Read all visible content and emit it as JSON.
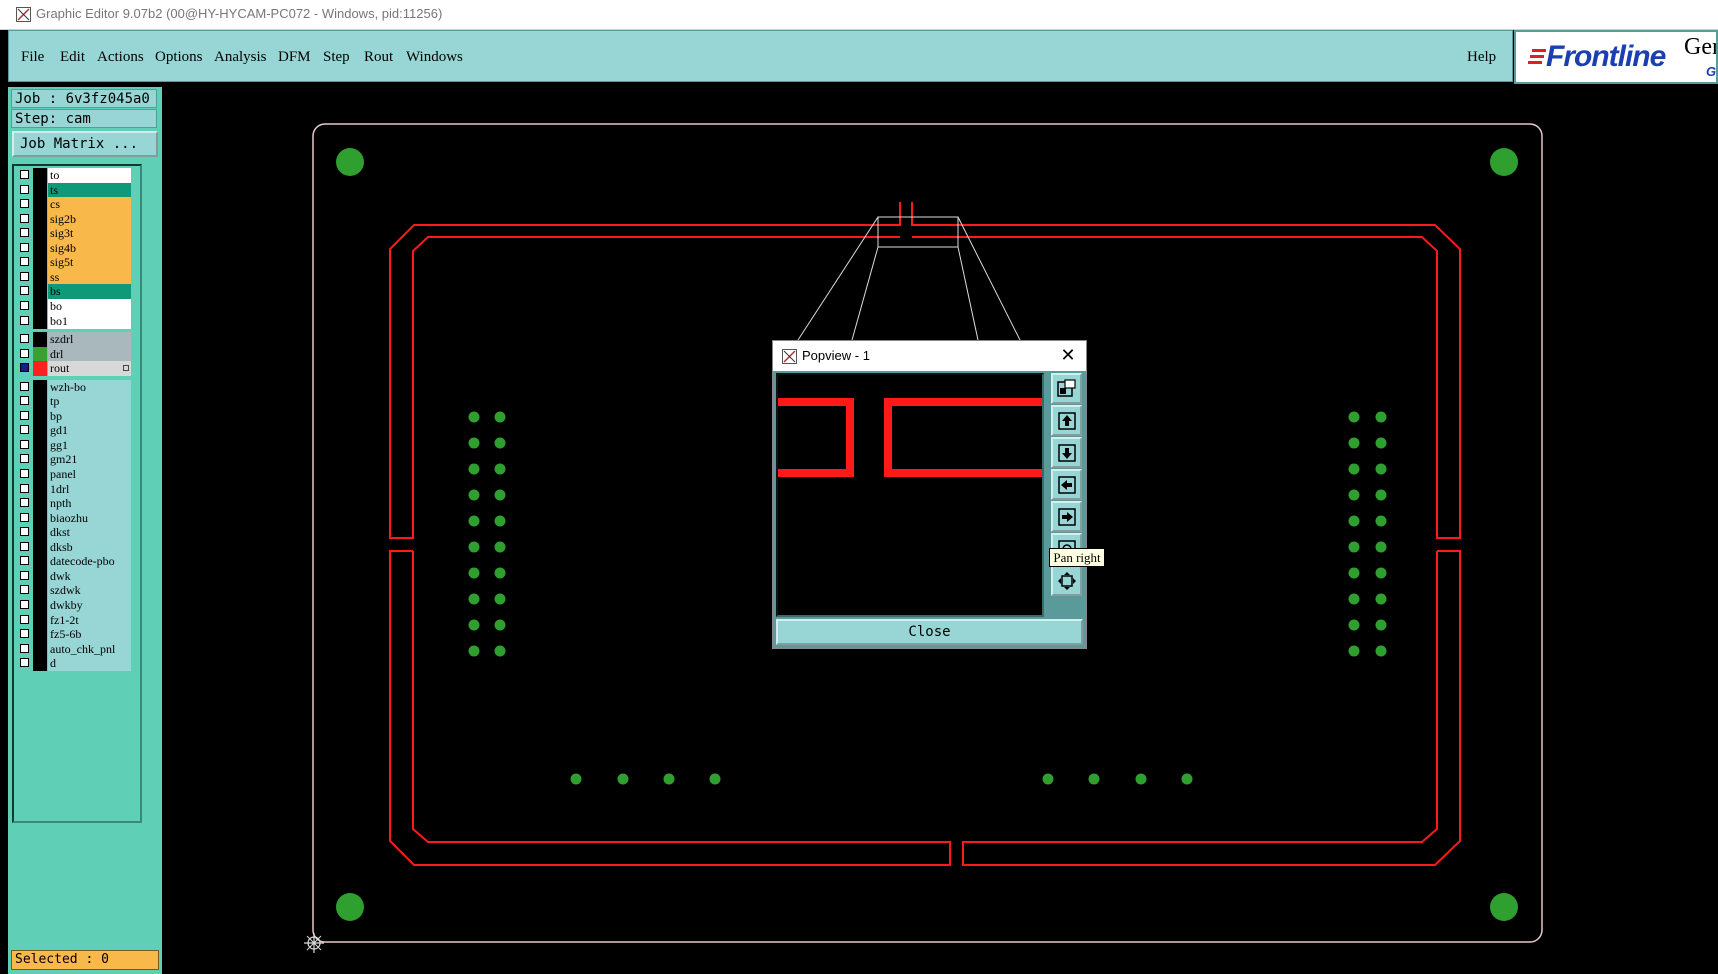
{
  "window": {
    "title": "Graphic Editor 9.07b2 (00@HY-HYCAM-PC072 - Windows, pid:11256)"
  },
  "menubar": {
    "items": [
      "File",
      "Edit",
      "Actions",
      "Options",
      "Analysis",
      "DFM",
      "Step",
      "Rout",
      "Windows"
    ],
    "help": "Help"
  },
  "logo": {
    "text": "Frontline",
    "suffix": "Ger",
    "sub": "G"
  },
  "sidebar": {
    "job": "Job : 6v3fz045a0",
    "step": "Step: cam",
    "job_matrix": "Job Matrix ...",
    "selected": "Selected : 0",
    "colors": {
      "white": "#ffffff",
      "teal": "#0e9a78",
      "orange": "#f8b84a",
      "gray": "#a8b8bc",
      "light": "#98d6d6",
      "green": "#3aa030",
      "red": "#ff2020",
      "rout": "#d8d8d8"
    },
    "layers": [
      {
        "name": "to",
        "color": "white",
        "group": 0
      },
      {
        "name": "ts",
        "color": "teal",
        "group": 0
      },
      {
        "name": "cs",
        "color": "orange",
        "group": 0
      },
      {
        "name": "sig2b",
        "color": "orange",
        "group": 0
      },
      {
        "name": "sig3t",
        "color": "orange",
        "group": 0
      },
      {
        "name": "sig4b",
        "color": "orange",
        "group": 0
      },
      {
        "name": "sig5t",
        "color": "orange",
        "group": 0
      },
      {
        "name": "ss",
        "color": "orange",
        "group": 0
      },
      {
        "name": "bs",
        "color": "teal",
        "group": 0
      },
      {
        "name": "bo",
        "color": "white",
        "group": 0
      },
      {
        "name": "bo1",
        "color": "white",
        "group": 0
      },
      {
        "name": "szdrl",
        "color": "gray",
        "group": 1
      },
      {
        "name": "drl",
        "color": "gray",
        "group": 1,
        "swatch": "green"
      },
      {
        "name": "rout",
        "color": "rout",
        "group": 1,
        "swatch": "red",
        "active": true
      },
      {
        "name": "wzh-bo",
        "color": "light",
        "group": 2
      },
      {
        "name": "tp",
        "color": "light",
        "group": 2
      },
      {
        "name": "bp",
        "color": "light",
        "group": 2
      },
      {
        "name": "gd1",
        "color": "light",
        "group": 2
      },
      {
        "name": "gg1",
        "color": "light",
        "group": 2
      },
      {
        "name": "gm21",
        "color": "light",
        "group": 2
      },
      {
        "name": "panel",
        "color": "light",
        "group": 2
      },
      {
        "name": "1drl",
        "color": "light",
        "group": 2
      },
      {
        "name": "npth",
        "color": "light",
        "group": 2
      },
      {
        "name": "biaozhu",
        "color": "light",
        "group": 2
      },
      {
        "name": "dkst",
        "color": "light",
        "group": 2
      },
      {
        "name": "dksb",
        "color": "light",
        "group": 2
      },
      {
        "name": "datecode-pbo",
        "color": "light",
        "group": 2
      },
      {
        "name": "dwk",
        "color": "light",
        "group": 2
      },
      {
        "name": "szdwk",
        "color": "light",
        "group": 2
      },
      {
        "name": "dwkby",
        "color": "light",
        "group": 2
      },
      {
        "name": "fz1-2t",
        "color": "light",
        "group": 2
      },
      {
        "name": "fz5-6b",
        "color": "light",
        "group": 2
      },
      {
        "name": "auto_chk_pnl",
        "color": "light",
        "group": 2
      },
      {
        "name": "d",
        "color": "light",
        "group": 2
      }
    ]
  },
  "popview": {
    "title": "Popview - 1",
    "close_label": "Close",
    "tools": [
      "zoom-fit-icon",
      "pan-up-icon",
      "pan-down-icon",
      "pan-left-icon",
      "pan-right-icon",
      "zoom-icon",
      "zoom-extents-icon"
    ]
  },
  "tooltip": {
    "text": "Pan right"
  },
  "colors": {
    "rout": "#ff1a1a",
    "outline": "#e6c8c8",
    "drill": "#2fa02f"
  }
}
